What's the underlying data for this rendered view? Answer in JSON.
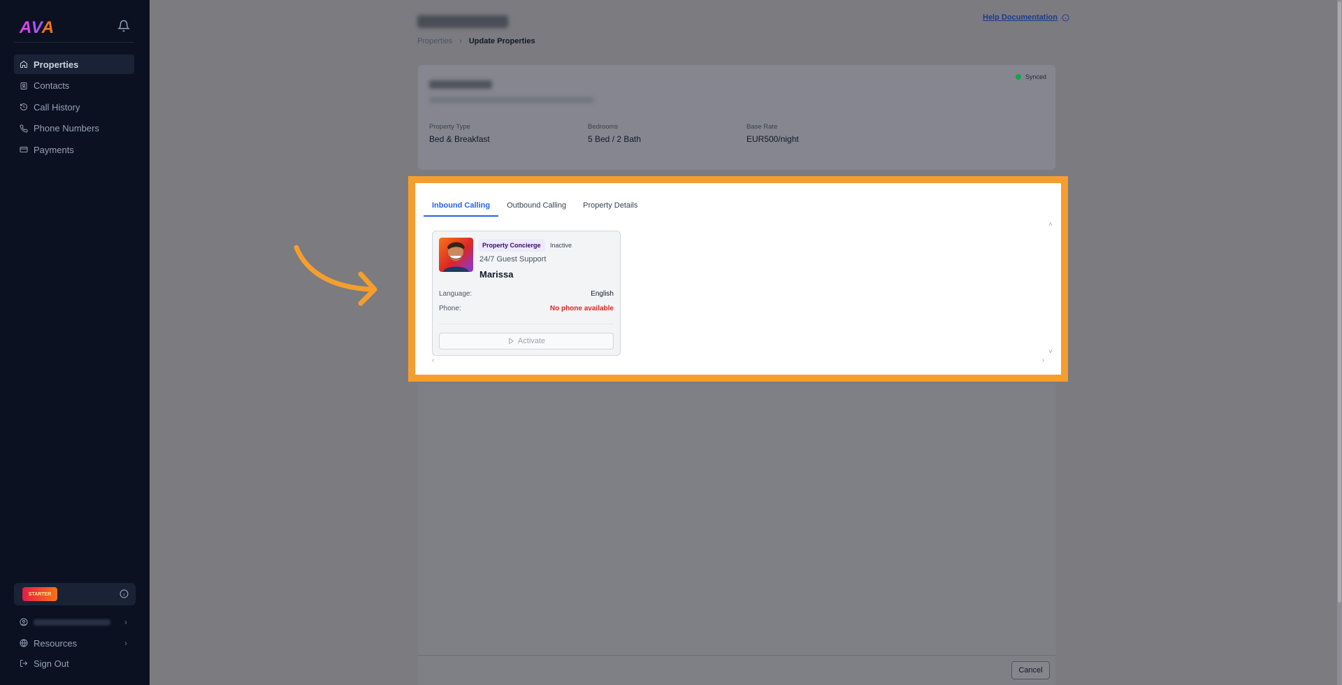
{
  "sidebar": {
    "logo": {
      "p1": "A",
      "p2": "V",
      "p3": "A"
    },
    "items": [
      {
        "label": "Properties",
        "icon": "home-icon"
      },
      {
        "label": "Contacts",
        "icon": "contact-book-icon"
      },
      {
        "label": "Call History",
        "icon": "history-icon"
      },
      {
        "label": "Phone Numbers",
        "icon": "phone-icon"
      },
      {
        "label": "Payments",
        "icon": "credit-card-icon"
      }
    ],
    "plan_badge": "STARTER",
    "resources_label": "Resources",
    "signout_label": "Sign Out"
  },
  "breadcrumb": {
    "root": "Properties",
    "current": "Update Properties"
  },
  "help_label": "Help Documentation",
  "property": {
    "sync_status": "Synced",
    "facts": [
      {
        "label": "Property Type",
        "value": "Bed & Breakfast"
      },
      {
        "label": "Bedrooms",
        "value": "5 Bed / 2 Bath"
      },
      {
        "label": "Base Rate",
        "value": "EUR500/night"
      }
    ]
  },
  "tabs": [
    "Inbound Calling",
    "Outbound Calling",
    "Property Details"
  ],
  "agent": {
    "role_tag": "Property Concierge",
    "status_tag": "Inactive",
    "subtitle": "24/7 Guest Support",
    "name": "Marissa",
    "language_label": "Language:",
    "language_value": "English",
    "phone_label": "Phone:",
    "phone_value": "No phone available",
    "activate_label": "Activate"
  },
  "cancel_label": "Cancel",
  "colors": {
    "highlight": "#f59e2e",
    "accent": "#2563eb",
    "warning": "#dc2626",
    "synced": "#16a34a"
  }
}
